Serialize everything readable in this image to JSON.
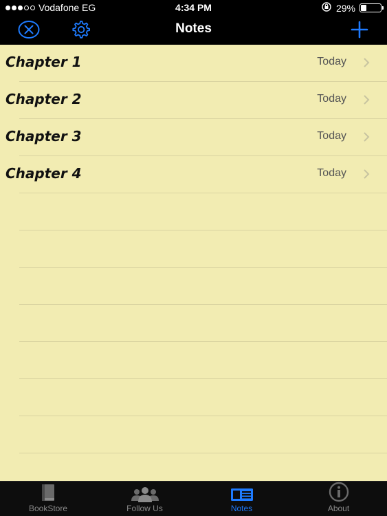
{
  "status": {
    "carrier": "Vodafone EG",
    "time": "4:34 PM",
    "battery": "29%",
    "battery_level": 0.29,
    "signal_bars_filled": 3,
    "signal_bars_total": 5
  },
  "nav": {
    "title": "Notes",
    "left_icons": [
      "close-circle-icon",
      "gear-icon"
    ],
    "right_icon": "plus-icon"
  },
  "notes": [
    {
      "title": "Chapter 1",
      "date": "Today"
    },
    {
      "title": "Chapter 2",
      "date": "Today"
    },
    {
      "title": "Chapter 3",
      "date": "Today"
    },
    {
      "title": "Chapter 4",
      "date": "Today"
    }
  ],
  "tabs": [
    {
      "label": "BookStore",
      "icon": "book-icon",
      "active": false
    },
    {
      "label": "Follow Us",
      "icon": "people-icon",
      "active": false
    },
    {
      "label": "Notes",
      "icon": "notes-card-icon",
      "active": true
    },
    {
      "label": "About",
      "icon": "info-icon",
      "active": false
    }
  ],
  "colors": {
    "accent": "#1e7bff",
    "paper": "#f2ecb2",
    "bar": "#000000"
  }
}
